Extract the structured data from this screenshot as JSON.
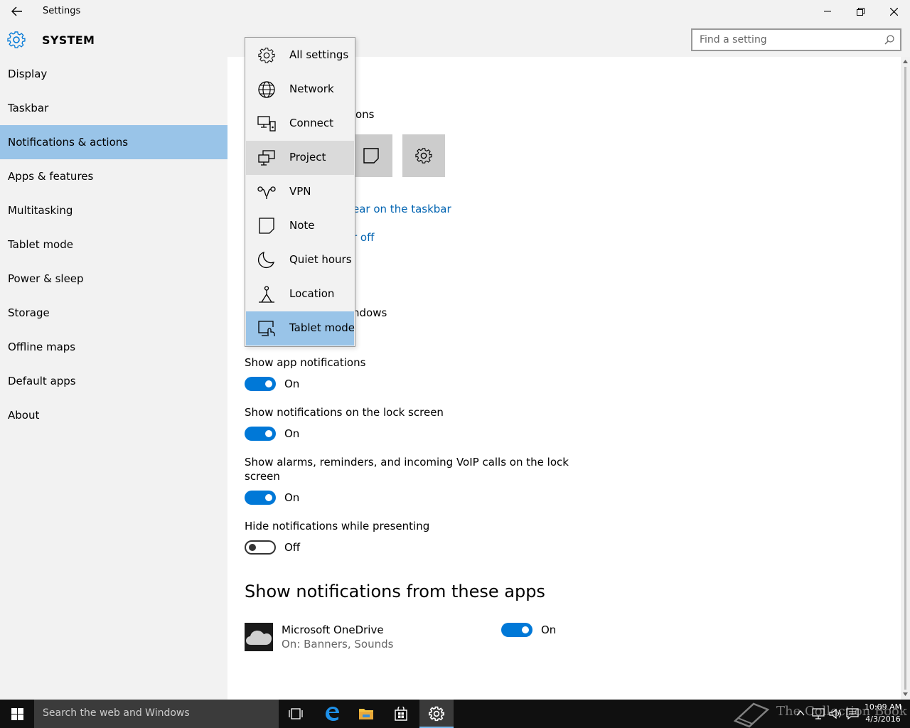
{
  "window": {
    "title": "Settings",
    "back_icon": "back-arrow-icon",
    "controls": [
      "minimize-icon",
      "restore-icon",
      "close-icon"
    ]
  },
  "header": {
    "section_title": "SYSTEM",
    "section_icon": "gear-icon",
    "search_placeholder": "Find a setting",
    "search_icon": "search-icon"
  },
  "sidebar": {
    "items": [
      {
        "label": "Display"
      },
      {
        "label": "Taskbar"
      },
      {
        "label": "Notifications & actions",
        "selected": true
      },
      {
        "label": "Apps & features"
      },
      {
        "label": "Multitasking"
      },
      {
        "label": "Tablet mode"
      },
      {
        "label": "Power & sleep"
      },
      {
        "label": "Storage"
      },
      {
        "label": "Offline maps"
      },
      {
        "label": "Default apps"
      },
      {
        "label": "About"
      }
    ]
  },
  "main": {
    "partial_quick_actions_label": "ons",
    "partial_link_taskbar": "ear on the taskbar",
    "partial_link_off": "r off",
    "partial_windows_text": "ndows",
    "quick_action_tiles": [
      "note-icon",
      "gear-icon"
    ],
    "settings": [
      {
        "label": "Show app notifications",
        "state": "On"
      },
      {
        "label": "Show notifications on the lock screen",
        "state": "On"
      },
      {
        "label_line1": "Show alarms, reminders, and incoming VoIP calls on the lock",
        "label_line2": "screen",
        "state": "On"
      },
      {
        "label": "Hide notifications while presenting",
        "state": "Off"
      }
    ],
    "apps_heading": "Show notifications from these apps",
    "apps": [
      {
        "name": "Microsoft OneDrive",
        "detail": "On: Banners, Sounds",
        "state": "On",
        "icon": "onedrive-cloud-icon"
      }
    ]
  },
  "flyout": {
    "items": [
      {
        "label": "All settings",
        "icon": "gear-icon"
      },
      {
        "label": "Network",
        "icon": "globe-icon"
      },
      {
        "label": "Connect",
        "icon": "connect-icon"
      },
      {
        "label": "Project",
        "icon": "project-icon",
        "hover": true
      },
      {
        "label": "VPN",
        "icon": "vpn-icon"
      },
      {
        "label": "Note",
        "icon": "note-icon"
      },
      {
        "label": "Quiet hours",
        "icon": "moon-icon"
      },
      {
        "label": "Location",
        "icon": "location-icon"
      },
      {
        "label": "Tablet mode",
        "icon": "tablet-mode-icon",
        "selected": true
      }
    ]
  },
  "taskbar": {
    "search_text": "Search the web and Windows",
    "icons": [
      "windows-start-icon",
      "task-view-icon",
      "edge-icon",
      "file-explorer-icon",
      "store-icon",
      "settings-icon"
    ],
    "watermark": "The Collection Book",
    "time": "10:09 AM",
    "date": "4/3/2016"
  },
  "colors": {
    "accent": "#0078d7",
    "link": "#0063b1",
    "selected_bg": "#99c4e8",
    "chrome_bg": "#f2f2f2"
  }
}
